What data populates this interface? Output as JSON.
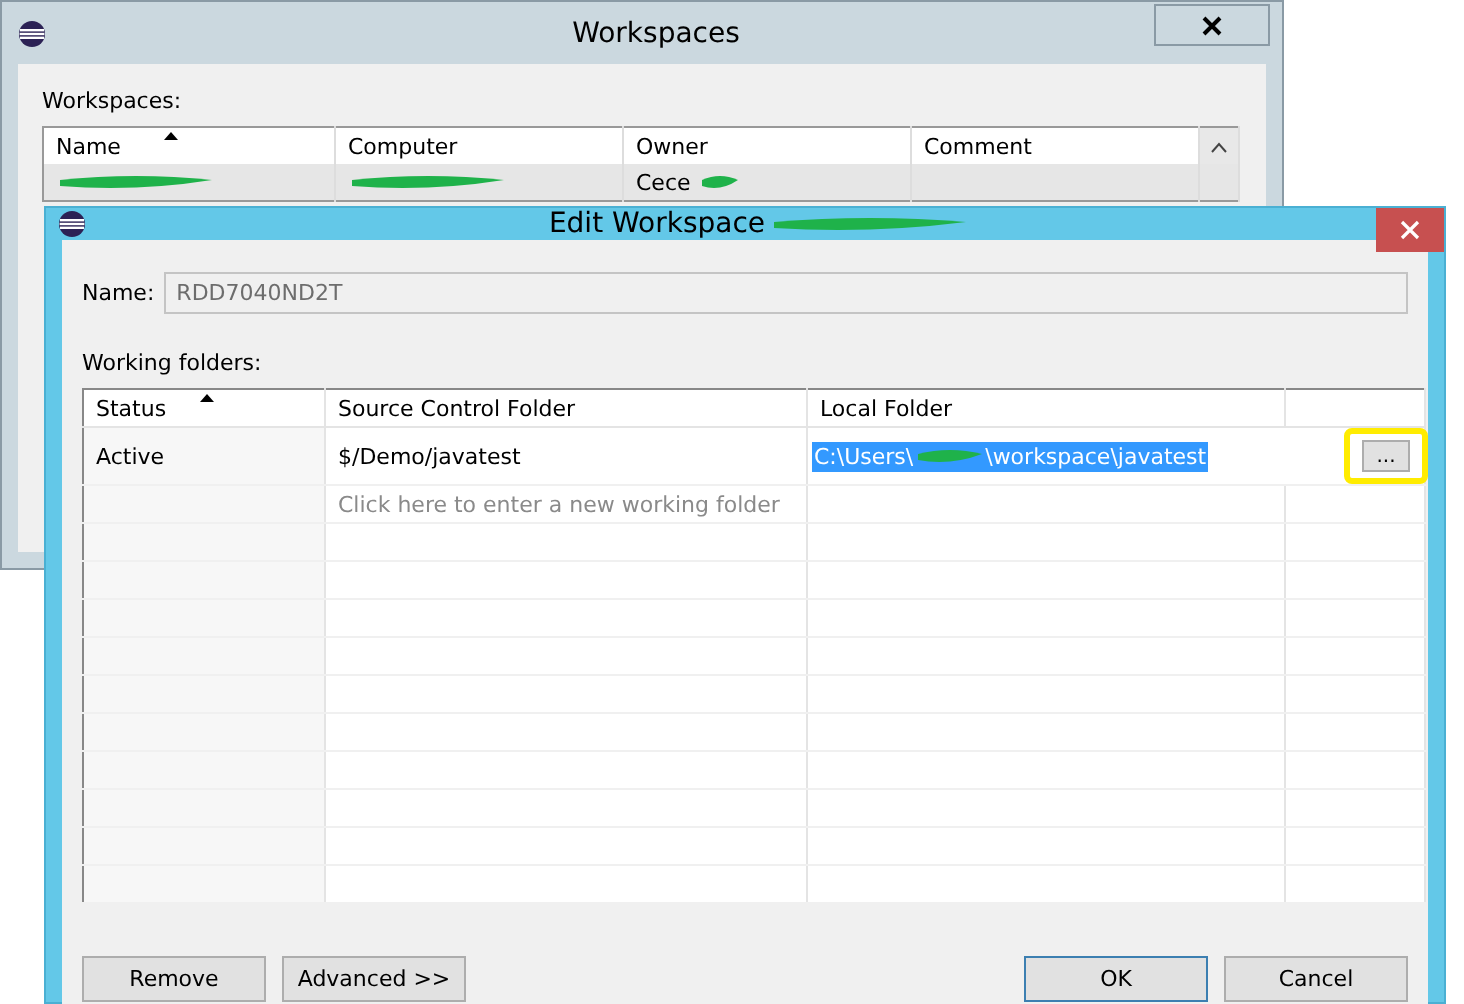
{
  "background_window": {
    "title": "Workspaces",
    "list_label": "Workspaces:",
    "columns": [
      {
        "label": "Name",
        "sorted": true
      },
      {
        "label": "Computer",
        "sorted": false
      },
      {
        "label": "Owner",
        "sorted": false
      },
      {
        "label": "Comment",
        "sorted": false
      }
    ],
    "rows": [
      {
        "owner": "Cece"
      }
    ]
  },
  "dialog": {
    "title": "Edit Workspace",
    "name_label": "Name:",
    "name_value": "RDD7040ND2T",
    "folders_label": "Working folders:",
    "columns": [
      {
        "label": "Status",
        "sorted": true
      },
      {
        "label": "Source Control Folder",
        "sorted": false
      },
      {
        "label": "Local Folder",
        "sorted": false
      }
    ],
    "rows": [
      {
        "status": "Active",
        "source": "$/Demo/javatest",
        "local_start": "C:\\Users\\",
        "local_end": "\\workspace\\javatest",
        "selected": true
      }
    ],
    "new_row_placeholder": "Click here to enter a new working folder",
    "browse_button": "...",
    "buttons": [
      {
        "label": "Remove",
        "default": false
      },
      {
        "label": "Advanced >>",
        "default": false
      },
      {
        "label": "OK",
        "default": true
      },
      {
        "label": "Cancel",
        "default": false
      }
    ]
  }
}
